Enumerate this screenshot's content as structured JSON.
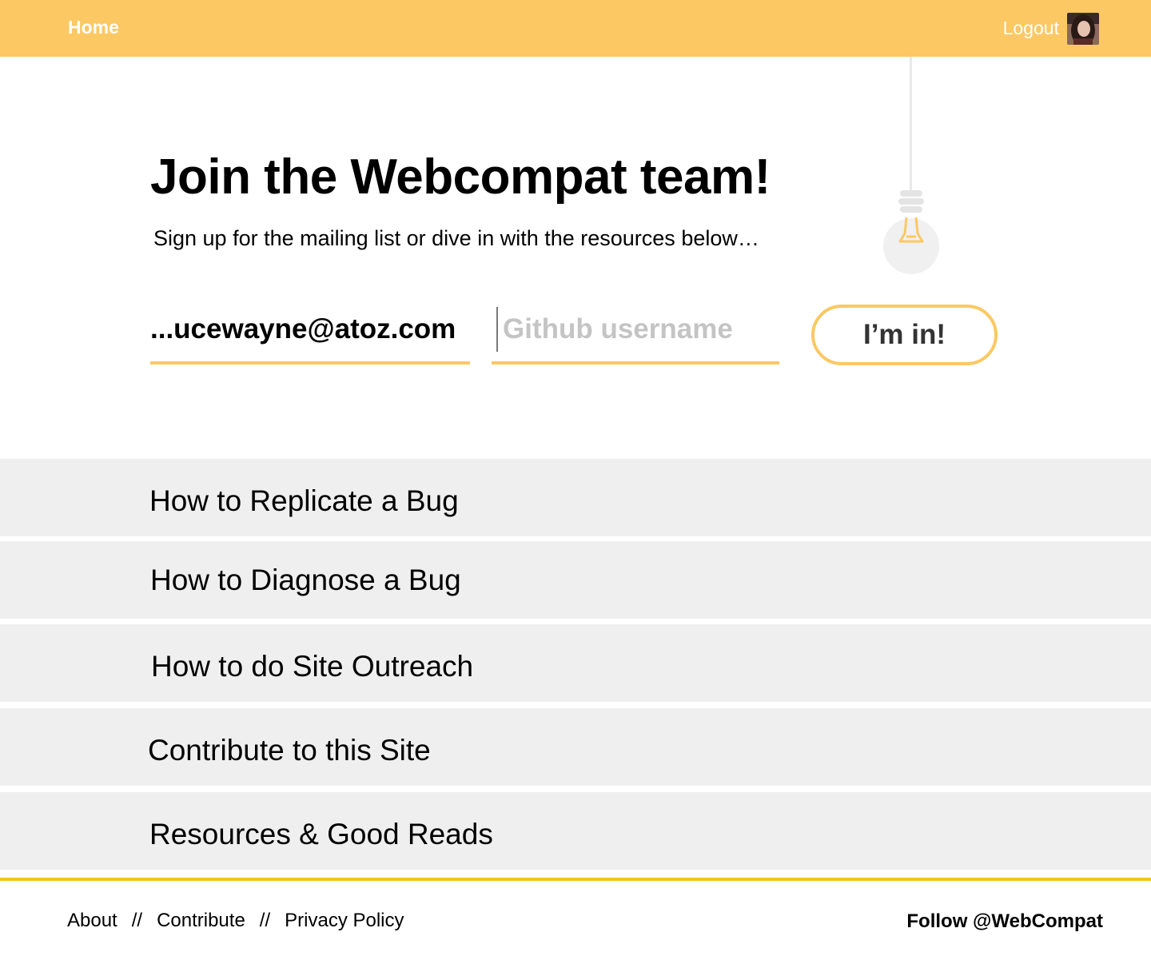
{
  "nav": {
    "home_label": "Home",
    "logout_label": "Logout",
    "avatar_icon": "user-avatar"
  },
  "hero": {
    "title": "Join the Webcompat team!",
    "subtitle": "Sign up for the mailing list or dive in with the resources below…",
    "illustration_icon": "lightbulb-icon"
  },
  "signup": {
    "email_value": "...ucewayne@atoz.com",
    "github_placeholder": "Github username",
    "github_value": "",
    "submit_label": "I’m in!"
  },
  "resources": [
    {
      "label": "How to Replicate a Bug"
    },
    {
      "label": "How to Diagnose a Bug"
    },
    {
      "label": "How to do Site Outreach"
    },
    {
      "label": "Contribute to this Site"
    },
    {
      "label": "Resources & Good Reads"
    }
  ],
  "footer": {
    "links": [
      "About",
      "Contribute",
      "Privacy Policy"
    ],
    "separator": "//",
    "follow_label": "Follow @WebCompat"
  },
  "colors": {
    "accent": "#fbc863",
    "footer_rule": "#f5c518",
    "resource_bg": "#efefef"
  }
}
